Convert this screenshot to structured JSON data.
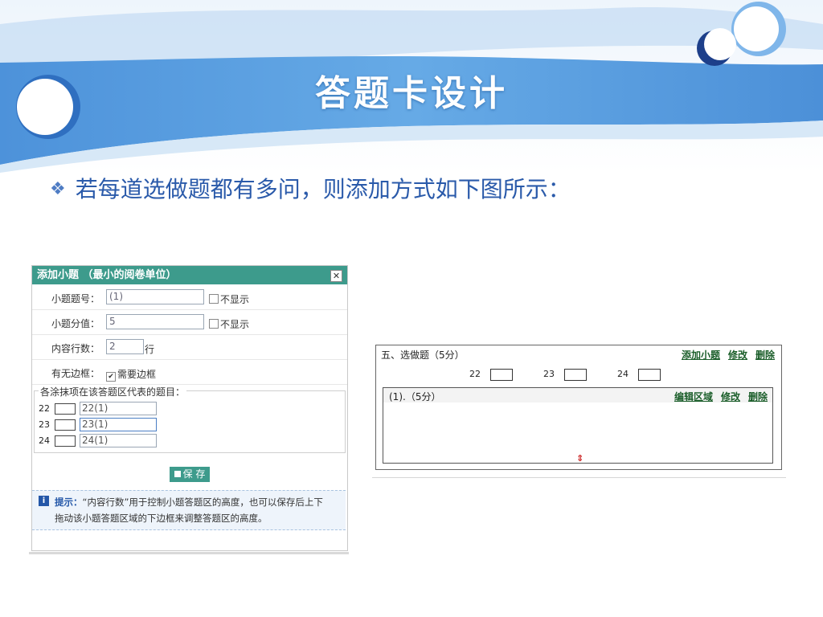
{
  "slide": {
    "title": "答题卡设计",
    "bullet": "若每道选做题都有多问，则添加方式如下图所示：",
    "bullet_icon": "diamond-bullet-icon",
    "colors": {
      "banner_blue": "#5aa1e2",
      "title_text": "#ffffff",
      "bullet_text": "#2a5aaa",
      "dialog_header": "#3d9b8c",
      "link_green": "#1b5e2a"
    }
  },
  "dialog": {
    "title": "添加小题 （最小的阅卷单位）",
    "close_symbol": "✕",
    "fields": {
      "number": {
        "label": "小题题号：",
        "value": "(1)",
        "option": "不显示"
      },
      "score": {
        "label": "小题分值：",
        "value": "5",
        "option": "不显示"
      },
      "lines": {
        "label": "内容行数：",
        "value": "2",
        "suffix": "行"
      },
      "border": {
        "label": "有无边框：",
        "check_mark": "✔",
        "option": "需要边框"
      }
    },
    "mapping_legend": "各涂抹项在该答题区代表的题目：",
    "mapping": [
      {
        "num": "22",
        "value": "22(1)"
      },
      {
        "num": "23",
        "value": "23(1)"
      },
      {
        "num": "24",
        "value": "24(1)"
      }
    ],
    "save_label": "保 存",
    "tip": {
      "icon": "i",
      "prefix": "提示：",
      "line1": "“内容行数”用于控制小题答题区的高度，也可以保存后上下",
      "line2": "拖动该小题答题区域的下边框来调整答题区的高度。"
    }
  },
  "preview": {
    "title": "五、选做题（5分）",
    "links": [
      "添加小题",
      "修改",
      "删除"
    ],
    "choices": [
      "22",
      "23",
      "24"
    ],
    "sub": {
      "title": "(1).（5分）",
      "links": [
        "编辑区域",
        "修改",
        "删除"
      ]
    },
    "resize_symbol": "⇕"
  }
}
